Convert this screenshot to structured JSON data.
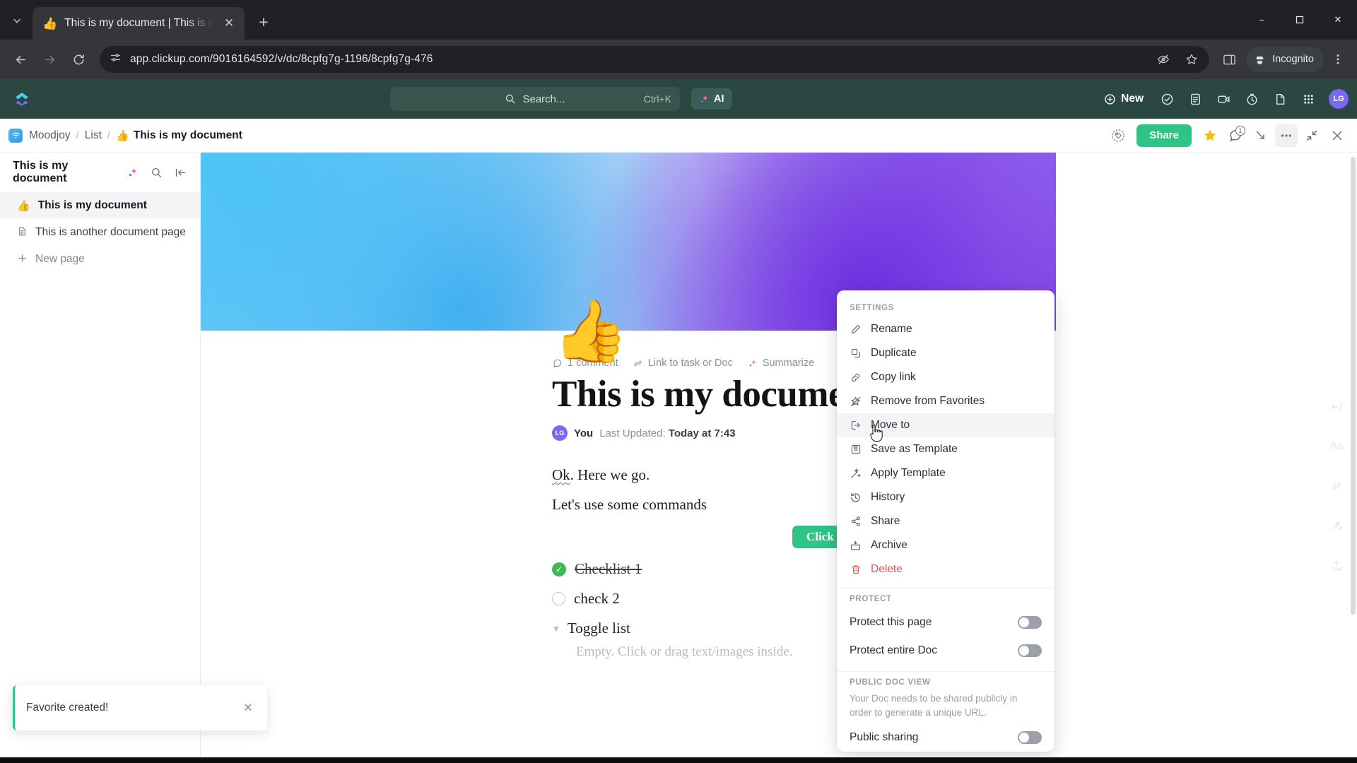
{
  "browser": {
    "tab": {
      "favicon": "thumbsup-emoji",
      "title": "This is my document | This is m"
    },
    "new_tab_label": "+",
    "url": "app.clickup.com/9016164592/v/dc/8cpfg7g-1196/8cpfg7g-476",
    "profile_label": "Incognito",
    "window_controls": {
      "minimize": "−",
      "maximize": "☐",
      "close": "✕"
    }
  },
  "clickup_header": {
    "search_placeholder": "Search...",
    "search_shortcut": "Ctrl+K",
    "ai_label": "AI",
    "new_label": "New",
    "avatar_initials": "LG"
  },
  "breadcrumb": {
    "workspace": "Moodjoy",
    "list": "List",
    "doc_emoji": "👍",
    "doc_title": "This is my document",
    "separator": "/",
    "share_label": "Share"
  },
  "doc_sidebar": {
    "title": "This is my document",
    "items": [
      {
        "emoji": "👍",
        "label": "This is my document",
        "selected": true
      },
      {
        "emoji": "page-icon",
        "label": "This is another document page",
        "selected": false
      }
    ],
    "new_page_label": "New page"
  },
  "document": {
    "cover_emoji": "👍",
    "comment_label": "1 comment",
    "link_label": "Link to task or Doc",
    "summarize_label": "Summarize",
    "title": "This is my document",
    "author": "You",
    "author_initials": "LG",
    "updated_prefix": "Last Updated:",
    "updated_value": "Today at 7:43",
    "paragraph_1_bad": "Ok",
    "paragraph_1_rest": ". Here we go.",
    "paragraph_2": "Let's use some commands",
    "button_label": "Click Me",
    "checklist": [
      {
        "label": "Checklist 1",
        "checked": true
      },
      {
        "label": "check 2",
        "checked": false
      }
    ],
    "toggle_label": "Toggle list",
    "toggle_empty_text": "Empty. Click or drag text/images inside."
  },
  "settings_menu": {
    "section_settings": "SETTINGS",
    "items": [
      {
        "icon": "pencil-icon",
        "label": "Rename"
      },
      {
        "icon": "duplicate-icon",
        "label": "Duplicate"
      },
      {
        "icon": "link-icon",
        "label": "Copy link"
      },
      {
        "icon": "star-off-icon",
        "label": "Remove from Favorites"
      },
      {
        "icon": "move-to-icon",
        "label": "Move to",
        "hovered": true
      },
      {
        "icon": "save-icon",
        "label": "Save as Template"
      },
      {
        "icon": "wand-icon",
        "label": "Apply Template"
      },
      {
        "icon": "history-icon",
        "label": "History"
      },
      {
        "icon": "share-icon",
        "label": "Share"
      },
      {
        "icon": "archive-icon",
        "label": "Archive"
      },
      {
        "icon": "trash-icon",
        "label": "Delete",
        "danger": true
      }
    ],
    "section_protect": "PROTECT",
    "protect_page_label": "Protect this page",
    "protect_doc_label": "Protect entire Doc",
    "section_public": "PUBLIC DOC VIEW",
    "public_help": "Your Doc needs to be shared publicly in order to generate a unique URL.",
    "public_sharing_label": "Public sharing"
  },
  "toast": {
    "message": "Favorite created!",
    "close": "✕"
  },
  "colors": {
    "clickup_green": "#2ec486",
    "header_dark_green": "#2b4741",
    "danger_red": "#e05252",
    "accent_purple": "#7b68ee"
  }
}
